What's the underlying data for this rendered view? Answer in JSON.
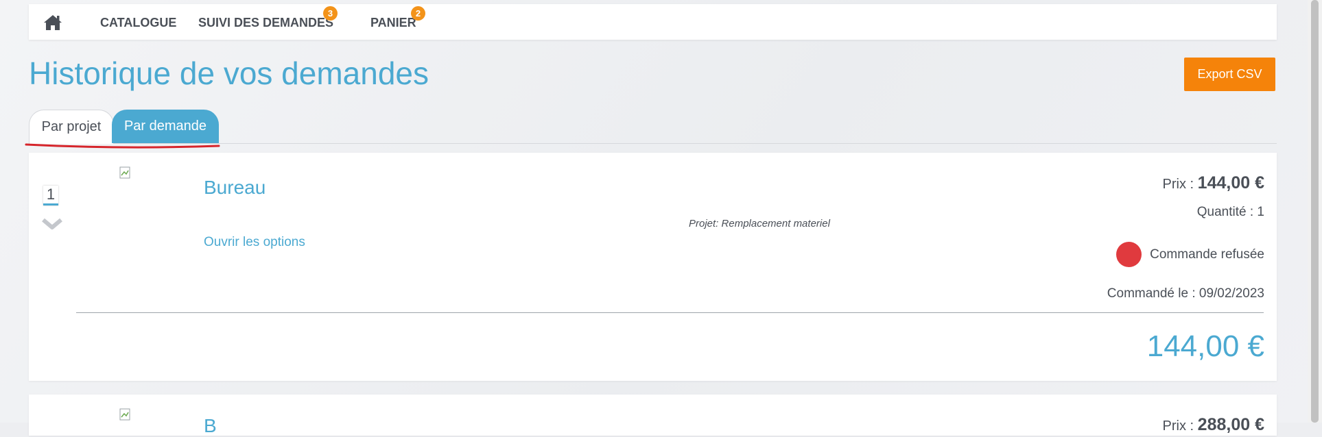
{
  "nav": {
    "items": [
      {
        "label": "CATALOGUE"
      },
      {
        "label": "SUIVI DES DEMANDES",
        "badge": "3"
      },
      {
        "label": "PANIER",
        "badge": "2"
      }
    ]
  },
  "page": {
    "title": "Historique de vos demandes",
    "export_label": "Export CSV"
  },
  "tabs": [
    {
      "label": "Par projet",
      "active": false
    },
    {
      "label": "Par demande",
      "active": true
    }
  ],
  "orders": [
    {
      "index": "1",
      "name": "Bureau",
      "options_link": "Ouvrir les options",
      "project": "Projet: Remplacement materiel",
      "price_label": "Prix : ",
      "price": "144,00 €",
      "quantity": "Quantité : 1",
      "status": "Commande refusée",
      "status_color": "#e03a3e",
      "date": "Commandé le : 09/02/2023",
      "total": "144,00 €"
    },
    {
      "name": "B",
      "price_label": "Prix : ",
      "price": "288,00 €"
    }
  ],
  "colors": {
    "accent": "#4ba9d1",
    "export": "#f5830a",
    "badge": "#f39319"
  },
  "icons": [
    "home-icon",
    "chevron-down-icon",
    "broken-image-icon"
  ]
}
